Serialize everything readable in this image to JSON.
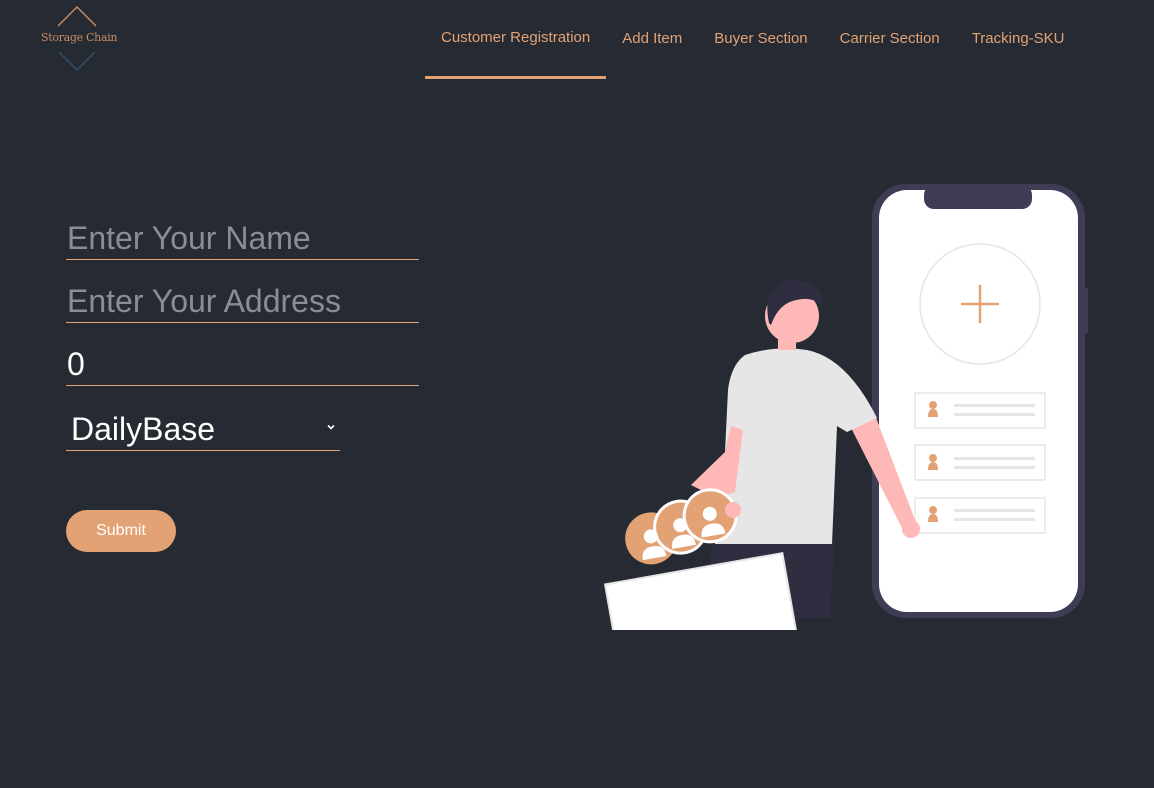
{
  "app": {
    "logo_text": "Storage Chain"
  },
  "nav": {
    "items": [
      {
        "label": "Customer Registration",
        "active": true
      },
      {
        "label": "Add Item",
        "active": false
      },
      {
        "label": "Buyer Section",
        "active": false
      },
      {
        "label": "Carrier Section",
        "active": false
      },
      {
        "label": "Tracking-SKU",
        "active": false
      }
    ]
  },
  "form": {
    "name": {
      "value": "",
      "placeholder": "Enter Your Name"
    },
    "address": {
      "value": "",
      "placeholder": "Enter Your Address"
    },
    "amount": {
      "value": "0"
    },
    "plan_select": {
      "selected": "DailyBase"
    },
    "submit_label": "Submit"
  },
  "colors": {
    "background": "#262a32",
    "accent": "#e3a274",
    "phone_frame": "#3f3d56",
    "skin": "#ffb8b8",
    "shirt": "#e6e6e6"
  },
  "icons": {
    "select_chevron": "chevron-down-icon",
    "plus": "plus-icon",
    "contact": "user-icon"
  }
}
